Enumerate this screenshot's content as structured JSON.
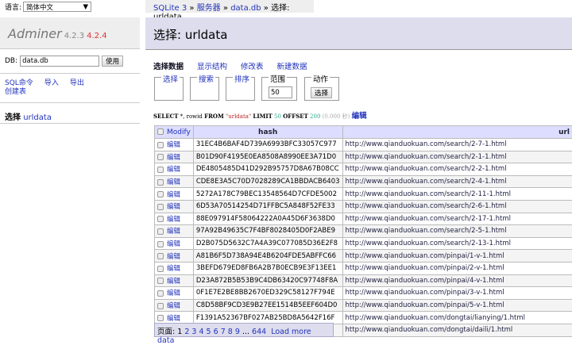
{
  "lang": {
    "label": "语言:",
    "value": "简体中文"
  },
  "sidebar": {
    "app": "Adminer",
    "version": "4.2.3",
    "new_version": "4.2.4",
    "db_label": "DB:",
    "db_value": "data.db",
    "use_btn": "使用",
    "links": [
      "SQL命令",
      "导入",
      "导出",
      "创建表"
    ],
    "select_label": "选择",
    "table": "urldata"
  },
  "breadcrumb": {
    "items": [
      "SQLite 3",
      "服务器",
      "data.db"
    ],
    "sep": "»",
    "current": "选择: urldata"
  },
  "title": "选择: urldata",
  "tabs": [
    "选择数据",
    "显示结构",
    "修改表",
    "新建数据"
  ],
  "fieldsets": {
    "select": "选择",
    "search": "搜索",
    "sort": "排序",
    "limit": "范围",
    "limit_value": "50",
    "action": "动作",
    "action_btn": "选择"
  },
  "sql": {
    "k1": "SELECT",
    "p1": " *, rowid ",
    "k2": "FROM",
    "s": " \"urldata\" ",
    "k3": "LIMIT",
    "n1": " 50 ",
    "k4": "OFFSET",
    "n2": " 200",
    "time": " (0.000 秒)",
    "edit": "编辑"
  },
  "table": {
    "headers": [
      "Modify",
      "hash",
      "url"
    ],
    "edit": "编辑",
    "rows": [
      [
        "31EC4B6BAF4D739A6993BFC33057C977",
        "http://www.qianduokuan.com/search/2-7-1.html"
      ],
      [
        "B01D90F4195E0EA8508A8990EE3A71D0",
        "http://www.qianduokuan.com/search/2-1-1.html"
      ],
      [
        "DE4805485D41D292B95757D8A67B08CC",
        "http://www.qianduokuan.com/search/2-2-1.html"
      ],
      [
        "CDE8E3A5C70D7028289CA1BBDACB6403",
        "http://www.qianduokuan.com/search/2-4-1.html"
      ],
      [
        "5272A178C79BEC13548564D7CFDE5002",
        "http://www.qianduokuan.com/search/2-11-1.html"
      ],
      [
        "6D53A70514254D71FFBC5A848F52FE33",
        "http://www.qianduokuan.com/search/2-6-1.html"
      ],
      [
        "88E097914F58064222A0A45D6F3638D0",
        "http://www.qianduokuan.com/search/2-17-1.html"
      ],
      [
        "97A92B49635C7F4BF8028405D0F2ABE9",
        "http://www.qianduokuan.com/search/2-5-1.html"
      ],
      [
        "D2B075D5632C7A4A39C077085D36E2F8",
        "http://www.qianduokuan.com/search/2-13-1.html"
      ],
      [
        "A81B6F5D738A94E4B6204FDE5ABFFC66",
        "http://www.qianduokuan.com/pinpai/1-v-1.html"
      ],
      [
        "3BEFD679ED8FB6A2B7B0ECB9E3F13EE1",
        "http://www.qianduokuan.com/pinpai/2-v-1.html"
      ],
      [
        "D23A872B5B53B9C4DB63420C97748F8A",
        "http://www.qianduokuan.com/pinpai/4-v-1.html"
      ],
      [
        "0F1E7E2BE8BB2670ED329C58127F794E",
        "http://www.qianduokuan.com/pinpai/3-v-1.html"
      ],
      [
        "C8D58BF9CD3E9B27EE1514B5EEF604D0",
        "http://www.qianduokuan.com/pinpai/5-v-1.html"
      ],
      [
        "F1391A52367BF027AB25BD8A5642F16F",
        "http://www.qianduokuan.com/dongtai/lianying/1.html"
      ],
      [
        "",
        "http://www.qianduokuan.com/dongtai/daili/1.html"
      ]
    ]
  },
  "pager": {
    "label": "页面:",
    "pages": [
      "1",
      "2",
      "3",
      "4",
      "5",
      "6",
      "7",
      "8",
      "9"
    ],
    "ellipsis": "...",
    "last": "644",
    "load_more": "Load more data"
  }
}
